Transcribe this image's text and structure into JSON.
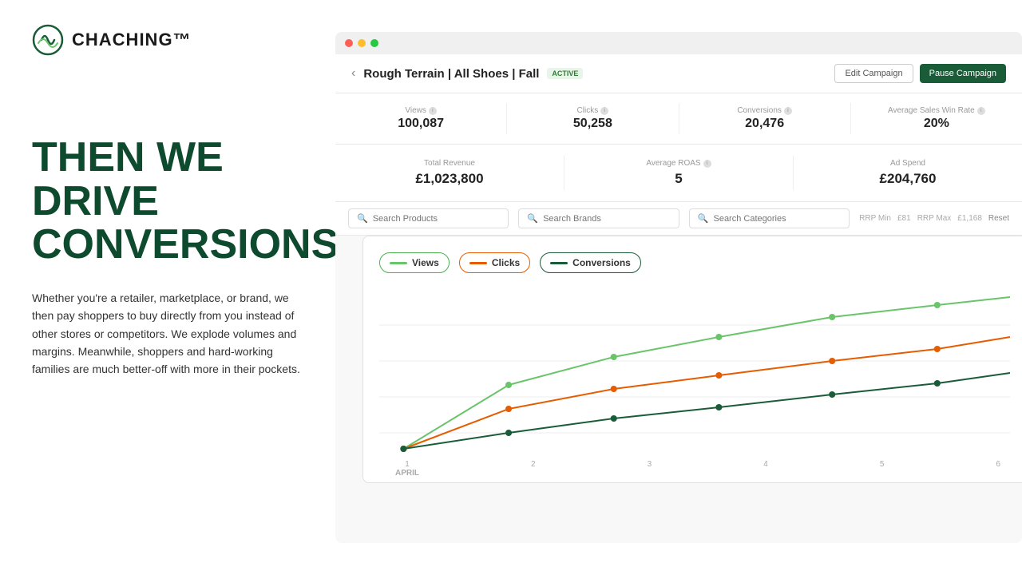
{
  "logo": {
    "text": "CHACHING™"
  },
  "headline": "THEN WE DRIVE CONVERSIONS.",
  "body_text": "Whether you're a retailer, marketplace, or brand, we then pay shoppers to buy directly from you instead of other stores or competitors. We explode volumes and margins. Meanwhile, shoppers and hard-working families are much better-off with more in their pockets.",
  "dashboard": {
    "browser_dots": [
      "red",
      "yellow",
      "green"
    ],
    "campaign": {
      "back_label": "‹",
      "title": "Rough Terrain | All Shoes | Fall",
      "status": "ACTIVE",
      "edit_btn": "Edit Campaign",
      "pause_btn": "Pause Campaign"
    },
    "stats": [
      {
        "label": "Views",
        "value": "100,087"
      },
      {
        "label": "Clicks",
        "value": "50,258"
      },
      {
        "label": "Conversions",
        "value": "20,476"
      },
      {
        "label": "Average Sales Win Rate",
        "value": "20%"
      }
    ],
    "revenue": [
      {
        "label": "Total Revenue",
        "value": "£1,023,800"
      },
      {
        "label": "Average ROAS",
        "value": "5"
      },
      {
        "label": "Ad Spend",
        "value": "£204,760"
      }
    ],
    "search": [
      {
        "placeholder": "Search Products"
      },
      {
        "placeholder": "Search Brands"
      },
      {
        "placeholder": "Search Categories"
      }
    ],
    "filter": {
      "rrp_min_label": "RRP Min",
      "rrp_min_val": "£81",
      "rrp_max_label": "RRP Max",
      "rrp_max_val": "£1,168",
      "reset_label": "Reset"
    },
    "chart": {
      "legend": [
        {
          "key": "views",
          "label": "Views",
          "color": "#6ac46a"
        },
        {
          "key": "clicks",
          "label": "Clicks",
          "color": "#e65c00"
        },
        {
          "key": "conversions",
          "label": "Conversions",
          "color": "#1a5c38"
        }
      ],
      "x_labels": [
        "1",
        "2",
        "3",
        "4",
        "5",
        "6"
      ],
      "x_month": "APRIL",
      "grid_lines": 4,
      "series": {
        "views": [
          0,
          145,
          175,
          190,
          215,
          240,
          260
        ],
        "clicks": [
          0,
          95,
          130,
          150,
          170,
          195,
          220
        ],
        "conversions": [
          0,
          40,
          65,
          90,
          115,
          140,
          165
        ]
      }
    }
  }
}
